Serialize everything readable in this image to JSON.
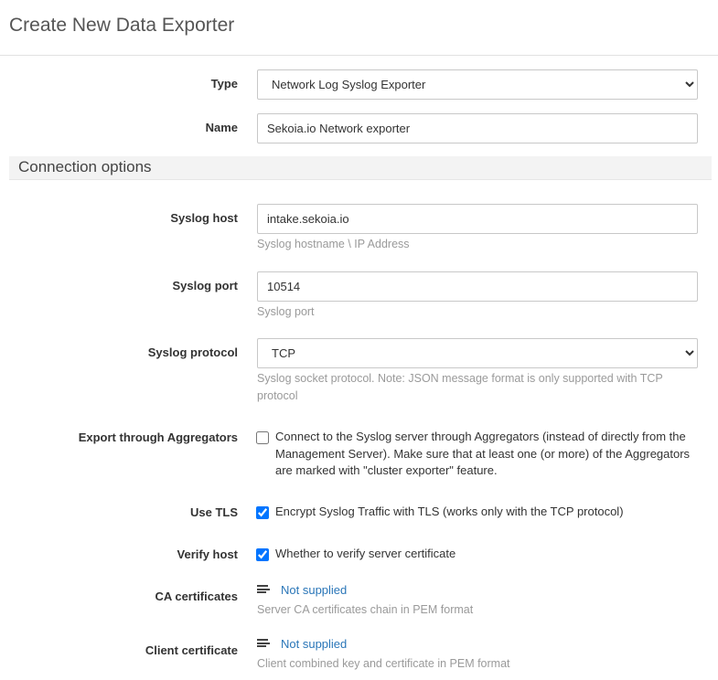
{
  "page": {
    "title": "Create New Data Exporter"
  },
  "form": {
    "type": {
      "label": "Type",
      "value": "Network Log Syslog Exporter"
    },
    "name": {
      "label": "Name",
      "value": "Sekoia.io Network exporter"
    }
  },
  "connection": {
    "section_title": "Connection options",
    "syslog_host": {
      "label": "Syslog host",
      "value": "intake.sekoia.io",
      "help": "Syslog hostname \\ IP Address"
    },
    "syslog_port": {
      "label": "Syslog port",
      "value": "10514",
      "help": "Syslog port"
    },
    "syslog_protocol": {
      "label": "Syslog protocol",
      "value": "TCP",
      "help": "Syslog socket protocol. Note: JSON message format is only supported with TCP protocol"
    },
    "export_aggregators": {
      "label": "Export through Aggregators",
      "checked": false,
      "text": "Connect to the Syslog server through Aggregators (instead of directly from the Management Server). Make sure that at least one (or more) of the Aggregators are marked with \"cluster exporter\" feature."
    },
    "use_tls": {
      "label": "Use TLS",
      "checked": true,
      "text": "Encrypt Syslog Traffic with TLS (works only with the TCP protocol)"
    },
    "verify_host": {
      "label": "Verify host",
      "checked": true,
      "text": "Whether to verify server certificate"
    },
    "ca_certificates": {
      "label": "CA certificates",
      "icon": "text-lines-icon",
      "link": "Not supplied",
      "help": "Server CA certificates chain in PEM format"
    },
    "client_certificate": {
      "label": "Client certificate",
      "icon": "text-lines-icon",
      "link": "Not supplied",
      "help": "Client combined key and certificate in PEM format"
    }
  },
  "colors": {
    "link": "#2a76b8",
    "help_text": "#9a9a9a",
    "section_bg": "#f3f3f3"
  }
}
